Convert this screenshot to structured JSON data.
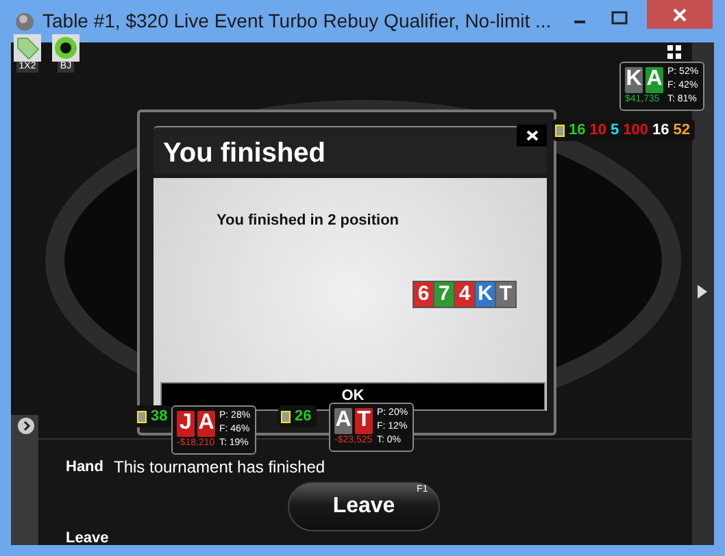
{
  "window": {
    "title": "Table #1, $320 Live Event Turbo Rebuy Qualifier, No-limit ..."
  },
  "toolbar": [
    {
      "label": "1X2",
      "kind": "tag"
    },
    {
      "label": "BJ",
      "kind": "chip"
    }
  ],
  "huds": [
    {
      "cards": [
        {
          "rank": "K",
          "color": "#6b6b6b"
        },
        {
          "rank": "A",
          "color": "#1f9a2e"
        }
      ],
      "stats": [
        "P: 52%",
        "F: 42%",
        "T: 81%"
      ],
      "amount": {
        "text": "$41,735",
        "color": "#22b83a"
      }
    },
    {
      "cards": [
        {
          "rank": "J",
          "color": "#c81e1e"
        },
        {
          "rank": "A",
          "color": "#c81e1e"
        }
      ],
      "stats": [
        "P: 28%",
        "F: 46%",
        "T: 19%"
      ],
      "amount": {
        "text": "-$18,210",
        "color": "#e0361e"
      }
    },
    {
      "cards": [
        {
          "rank": "A",
          "color": "#6b6b6b"
        },
        {
          "rank": "T",
          "color": "#c81e1e"
        }
      ],
      "stats": [
        "P: 20%",
        "F: 12%",
        "T: 0%"
      ],
      "amount": {
        "text": "-$23,525",
        "color": "#e0361e"
      }
    }
  ],
  "stat_bars": [
    {
      "numbers": [
        {
          "text": "16",
          "color": "#22cc22"
        },
        {
          "text": "10",
          "color": "#ee1111"
        },
        {
          "text": "5",
          "color": "#22ddee"
        },
        {
          "text": "100",
          "color": "#dd1111"
        },
        {
          "text": "16",
          "color": "#ffffff"
        },
        {
          "text": "52",
          "color": "#f5a030"
        }
      ]
    },
    {
      "numbers": [
        {
          "text": "38",
          "color": "#22cc22"
        }
      ]
    },
    {
      "numbers": [
        {
          "text": "26",
          "color": "#22cc22"
        }
      ]
    }
  ],
  "dialog": {
    "title": "You finished",
    "message": "You finished in 2 position",
    "cards": [
      {
        "rank": "6",
        "color": "#d42a2a"
      },
      {
        "rank": "7",
        "color": "#2f9a32"
      },
      {
        "rank": "4",
        "color": "#d42a2a"
      },
      {
        "rank": "K",
        "color": "#2f78d0"
      },
      {
        "rank": "T",
        "color": "#707070"
      }
    ],
    "ok_label": "OK"
  },
  "panel": {
    "rows": [
      {
        "label": "Hand",
        "value": "This tournament has finished"
      },
      {
        "label": "Leave"
      }
    ],
    "leave_button": {
      "label": "Leave",
      "shortcut": "F1"
    }
  }
}
